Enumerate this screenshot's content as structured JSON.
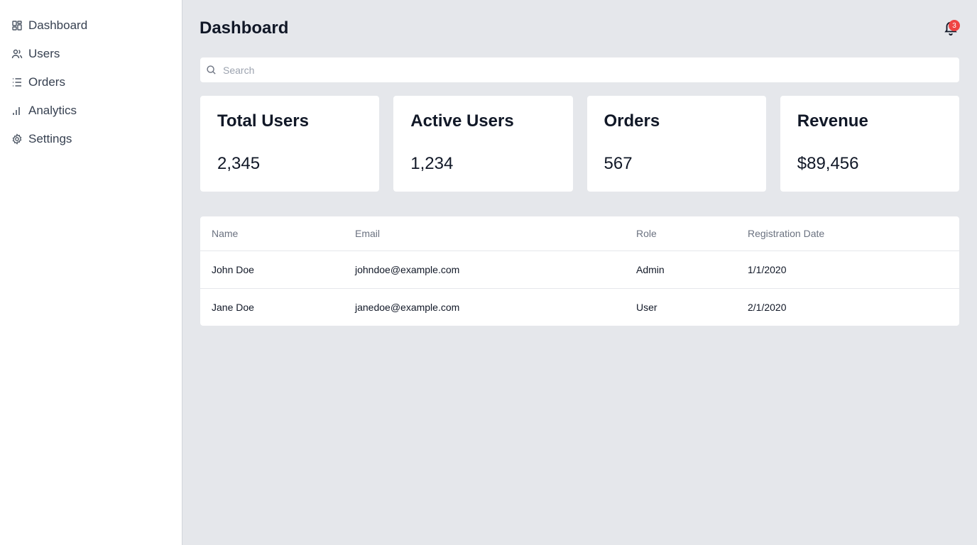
{
  "sidebar": {
    "items": [
      {
        "label": "Dashboard",
        "icon": "dashboard-grid-icon"
      },
      {
        "label": "Users",
        "icon": "users-icon"
      },
      {
        "label": "Orders",
        "icon": "list-icon"
      },
      {
        "label": "Analytics",
        "icon": "bar-chart-icon"
      },
      {
        "label": "Settings",
        "icon": "gear-icon"
      }
    ]
  },
  "header": {
    "title": "Dashboard",
    "notifications": {
      "count": "3",
      "icon": "bell-icon"
    }
  },
  "search": {
    "placeholder": "Search",
    "value": ""
  },
  "stats": [
    {
      "title": "Total Users",
      "value": "2,345"
    },
    {
      "title": "Active Users",
      "value": "1,234"
    },
    {
      "title": "Orders",
      "value": "567"
    },
    {
      "title": "Revenue",
      "value": "$89,456"
    }
  ],
  "table": {
    "headers": [
      "Name",
      "Email",
      "Role",
      "Registration Date"
    ],
    "rows": [
      [
        "John Doe",
        "johndoe@example.com",
        "Admin",
        "1/1/2020"
      ],
      [
        "Jane Doe",
        "janedoe@example.com",
        "User",
        "2/1/2020"
      ]
    ]
  },
  "colors": {
    "badge": "#ef4444",
    "background": "#e5e7eb",
    "surface": "#ffffff"
  }
}
